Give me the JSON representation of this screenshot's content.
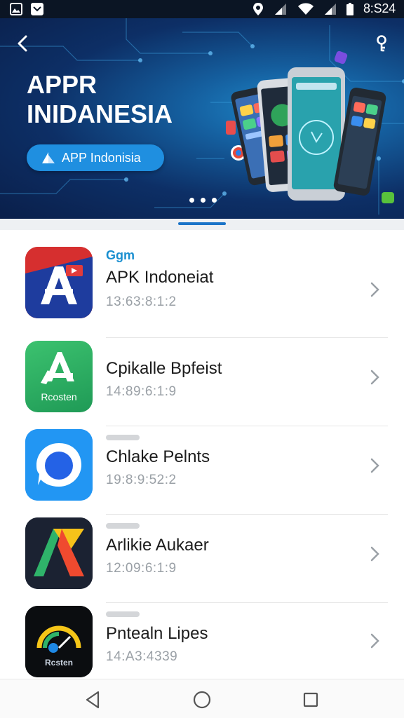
{
  "status_bar": {
    "time": "8:S24",
    "left_icons": [
      "gallery-icon",
      "mail-icon"
    ],
    "right_icons": [
      "location-icon",
      "signal-icon",
      "wifi-icon",
      "signal-icon-2",
      "battery-icon"
    ]
  },
  "hero": {
    "title_line1": "APPR",
    "title_line2": "INIDANESIA",
    "cta_label": "APP Indonisia",
    "carousel_dots": 3,
    "colors": {
      "background": "#0d2f66",
      "accent": "#1f8fe0"
    }
  },
  "apps": [
    {
      "tag": "Ggm",
      "name": "APK Indoneiat",
      "meta": "13:63:8:1:2",
      "icon": "red-blue-a-icon",
      "icon_label": ""
    },
    {
      "tag": "",
      "name": "Cpikalle Bpfeist",
      "meta": "14:89:6:1:9",
      "icon": "green-a-icon",
      "icon_label": "Rcosten"
    },
    {
      "tag": "",
      "name": "Chlake Pelnts",
      "meta": "19:8:9:52:2",
      "icon": "blue-circle-icon",
      "icon_label": ""
    },
    {
      "tag": "",
      "name": "Arlikie Aukaer",
      "meta": "12:09:6:1:9",
      "icon": "triangle-logo-icon",
      "icon_label": ""
    },
    {
      "tag": "",
      "name": "Pntealn Lipes",
      "meta": "14:A3:4339",
      "icon": "gauge-logo-icon",
      "icon_label": "Rcsten"
    }
  ],
  "nav": {
    "icons": [
      "back-triangle-icon",
      "home-circle-icon",
      "recents-square-icon"
    ]
  }
}
